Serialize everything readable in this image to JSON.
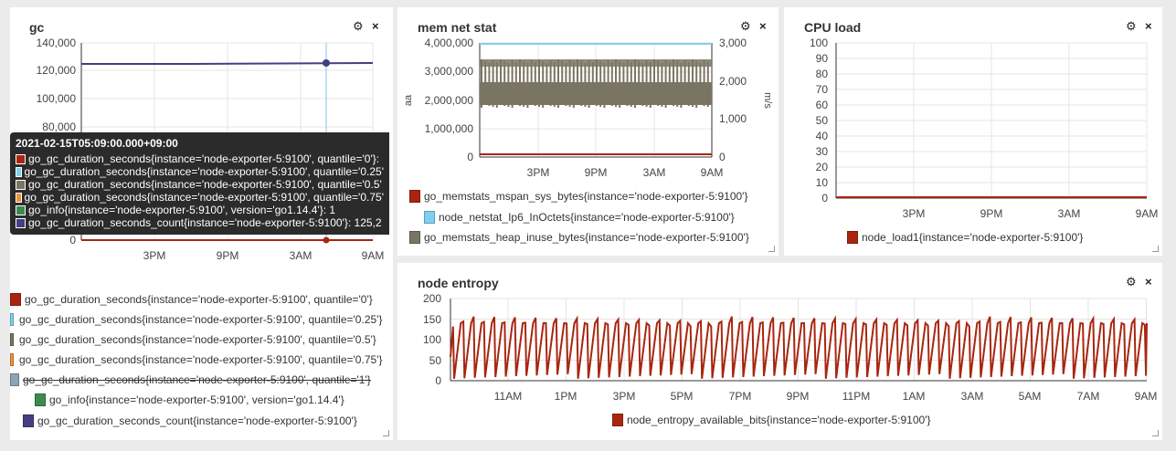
{
  "colors": {
    "red": "#a8260f",
    "lightblue": "#7fd0f0",
    "gray": "#7a7563",
    "orange": "#f0923a",
    "steel": "#8aa4b8",
    "green": "#3d8a4f",
    "navy": "#453e82",
    "crosshair": "#7fc8e8"
  },
  "gc": {
    "title": "gc",
    "y_ticks": [
      "140,000",
      "120,000",
      "100,000",
      "80,000",
      "0"
    ],
    "x_ticks": [
      "3PM",
      "9PM",
      "3AM",
      "9AM"
    ],
    "tooltip": {
      "header": "2021-02-15T05:09:00.000+09:00",
      "rows": [
        {
          "color": "red",
          "text": "go_gc_duration_seconds{instance='node-exporter-5:9100', quantile='0'}:"
        },
        {
          "color": "lightblue",
          "text": "go_gc_duration_seconds{instance='node-exporter-5:9100', quantile='0.25'"
        },
        {
          "color": "gray",
          "text": "go_gc_duration_seconds{instance='node-exporter-5:9100', quantile='0.5'"
        },
        {
          "color": "orange",
          "text": "go_gc_duration_seconds{instance='node-exporter-5:9100', quantile='0.75'"
        },
        {
          "color": "green",
          "text": "go_info{instance='node-exporter-5:9100', version='go1.14.4'}: 1"
        },
        {
          "color": "navy",
          "text": "go_gc_duration_seconds_count{instance='node-exporter-5:9100'}: 125,2"
        }
      ]
    },
    "legend": [
      "go_gc_duration_seconds{instance='node-exporter-5:9100', quantile='0'}",
      "go_gc_duration_seconds{instance='node-exporter-5:9100', quantile='0.25'}",
      "go_gc_duration_seconds{instance='node-exporter-5:9100', quantile='0.5'}",
      "go_gc_duration_seconds{instance='node-exporter-5:9100', quantile='0.75'}",
      "go_gc_duration_seconds{instance='node-exporter-5:9100', quantile='1'}",
      "go_info{instance='node-exporter-5:9100', version='go1.14.4'}",
      "go_gc_duration_seconds_count{instance='node-exporter-5:9100'}"
    ]
  },
  "mem": {
    "title": "mem net stat",
    "y_ticks_left": [
      "4,000,000",
      "3,000,000",
      "2,000,000",
      "1,000,000",
      "0"
    ],
    "y_ticks_right": [
      "3,000",
      "2,000",
      "1,000",
      "0"
    ],
    "ylabel_left": "aa",
    "ylabel_right": "m/s",
    "x_ticks": [
      "3PM",
      "9PM",
      "3AM",
      "9AM"
    ],
    "legend": [
      "go_memstats_mspan_sys_bytes{instance='node-exporter-5:9100'}",
      "node_netstat_Ip6_InOctets{instance='node-exporter-5:9100'}",
      "go_memstats_heap_inuse_bytes{instance='node-exporter-5:9100'}"
    ]
  },
  "cpu": {
    "title": "CPU load",
    "y_ticks": [
      "100",
      "90",
      "80",
      "70",
      "60",
      "50",
      "40",
      "30",
      "20",
      "10",
      "0"
    ],
    "x_ticks": [
      "3PM",
      "9PM",
      "3AM",
      "9AM"
    ],
    "legend": [
      "node_load1{instance='node-exporter-5:9100'}"
    ]
  },
  "entropy": {
    "title": "node entropy",
    "y_ticks": [
      "200",
      "150",
      "100",
      "50",
      "0"
    ],
    "x_ticks": [
      "11AM",
      "1PM",
      "3PM",
      "5PM",
      "7PM",
      "9PM",
      "11PM",
      "1AM",
      "3AM",
      "5AM",
      "7AM",
      "9AM"
    ],
    "legend": [
      "node_entropy_available_bits{instance='node-exporter-5:9100'}"
    ]
  },
  "icons": {
    "gear": "⚙",
    "close": "×"
  }
}
